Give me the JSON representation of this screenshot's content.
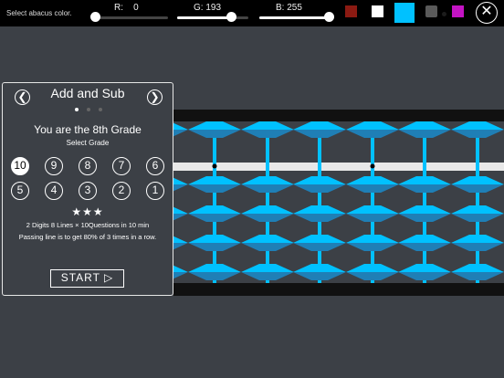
{
  "topbar": {
    "hint": "Select abacus color.",
    "r_label": "R:",
    "r_value": "0",
    "r_level": 0,
    "g_label": "G:",
    "g_value": "193",
    "g_level": 0.757,
    "b_label": "B:",
    "b_value": "255",
    "b_level": 1.0,
    "swatches": [
      "#8b1a12",
      "#ffffff",
      "#00c1ff",
      "#5a5a5a",
      "#1c1c1c",
      "#c414c4"
    ],
    "selected_swatch": "#00c1ff",
    "close_icon": "close-icon"
  },
  "panel": {
    "title": "Add and Sub",
    "prev_icon": "chevron-left-icon",
    "next_icon": "chevron-right-icon",
    "page_count": 3,
    "current_page": 1,
    "grade_title": "You are the 8th Grade",
    "select_grade": "Select  Grade",
    "grades_row1": [
      "10",
      "9",
      "8",
      "7",
      "6"
    ],
    "grades_row2": [
      "5",
      "4",
      "3",
      "2",
      "1"
    ],
    "selected_grade": "10",
    "stars": "★★★",
    "info_line1": "2 Digits  8 Lines × 10Questions  in  10 min",
    "info_line2": "Passing line is to get 80% of 3 times in a row.",
    "start_label": "START  ▷"
  },
  "abacus": {
    "bead_color": "#00c1ff",
    "rod_count": 6
  }
}
